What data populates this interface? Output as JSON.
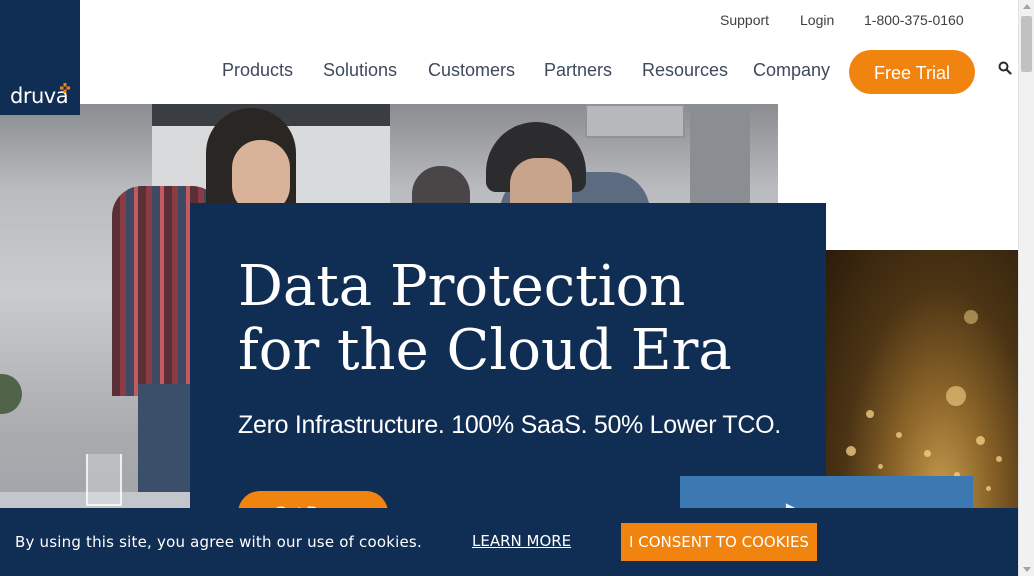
{
  "brand": {
    "logo_text": "druva",
    "accent": "#f0840f",
    "navy": "#102d54"
  },
  "utility_nav": {
    "support": "Support",
    "login": "Login",
    "phone": "1-800-375-0160"
  },
  "main_nav": {
    "items": [
      "Products",
      "Solutions",
      "Customers",
      "Partners",
      "Resources",
      "Company"
    ],
    "cta": "Free Trial",
    "search_icon": "search-icon"
  },
  "hero": {
    "title_line1": "Data Protection",
    "title_line2": "for the Cloud Era",
    "subtitle": "Zero Infrastructure. 100% SaaS. 50% Lower TCO.",
    "cta_label": "Get Demo",
    "play_icon": "play-icon"
  },
  "cookie_banner": {
    "message": "By using this site, you agree with our use of cookies.",
    "learn_more": "LEARN MORE",
    "consent": "I CONSENT TO COOKIES"
  }
}
